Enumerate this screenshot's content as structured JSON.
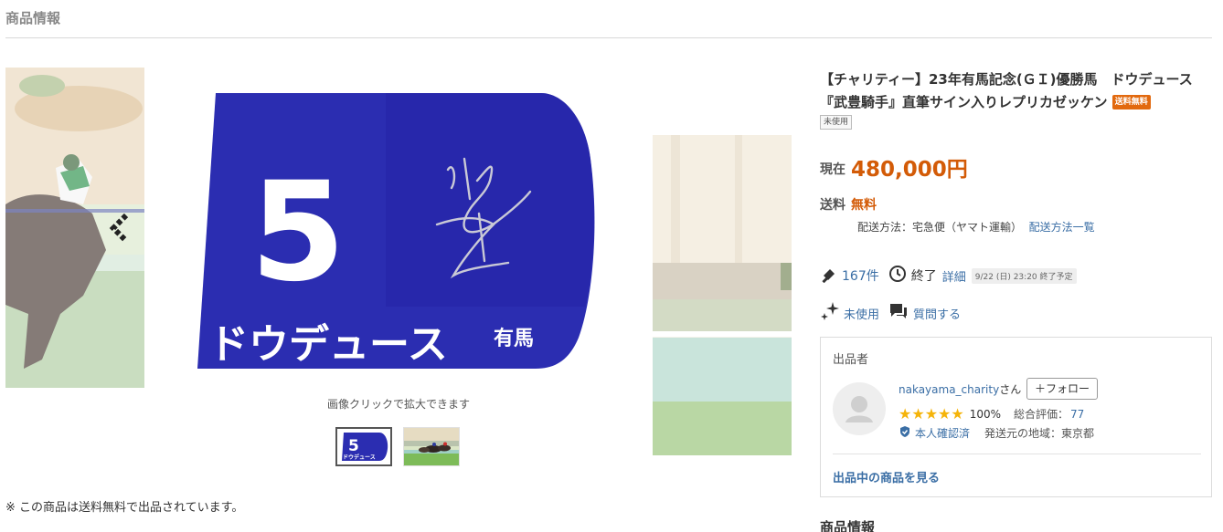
{
  "page": {
    "section_title": "商品情報"
  },
  "gallery": {
    "main_image": {
      "number": "5",
      "horse_name": "ドウデュース",
      "race_label": "有馬"
    },
    "thumbs": [
      {
        "number": "5",
        "label": "ドウデュース"
      }
    ],
    "zoom_note": "画像クリックで拡大できます"
  },
  "notes": {
    "free_shipping": "※ この商品は送料無料で出品されています。"
  },
  "item": {
    "title": "【チャリティー】23年有馬記念(ＧＩ)優勝馬　ドウデュース　『武豊騎手』直筆サイン入りレプリカゼッケン",
    "free_ship_badge": "送料無料",
    "condition_badge": "未使用"
  },
  "price": {
    "label": "現在",
    "value": "480,000円"
  },
  "shipping": {
    "label": "送料",
    "value": "無料",
    "method": "配送方法：宅急便（ヤマト運輸）",
    "method_link": "配送方法一覧"
  },
  "stats": {
    "bids": "167件",
    "status": "終了",
    "detail_link": "詳細",
    "end_date": "9/22 (日) 23:20 終了予定",
    "condition": "未使用",
    "ask": "質問する"
  },
  "seller": {
    "heading": "出品者",
    "name": "nakayama_charity",
    "suffix": "さん",
    "follow": "＋フォロー",
    "stars": "★★★★★",
    "positive_pct": "100%",
    "total_label": "総合評価：",
    "total_value": "77",
    "verified": "本人確認済",
    "region": "発送元の地域：東京都",
    "see_items": "出品中の商品を見る"
  },
  "right_section_heading": "商品情報",
  "colors": {
    "price": "#d35b07",
    "link": "#3a6ea5",
    "bib_blue": "#2b2db1",
    "star": "#f5b40a"
  }
}
